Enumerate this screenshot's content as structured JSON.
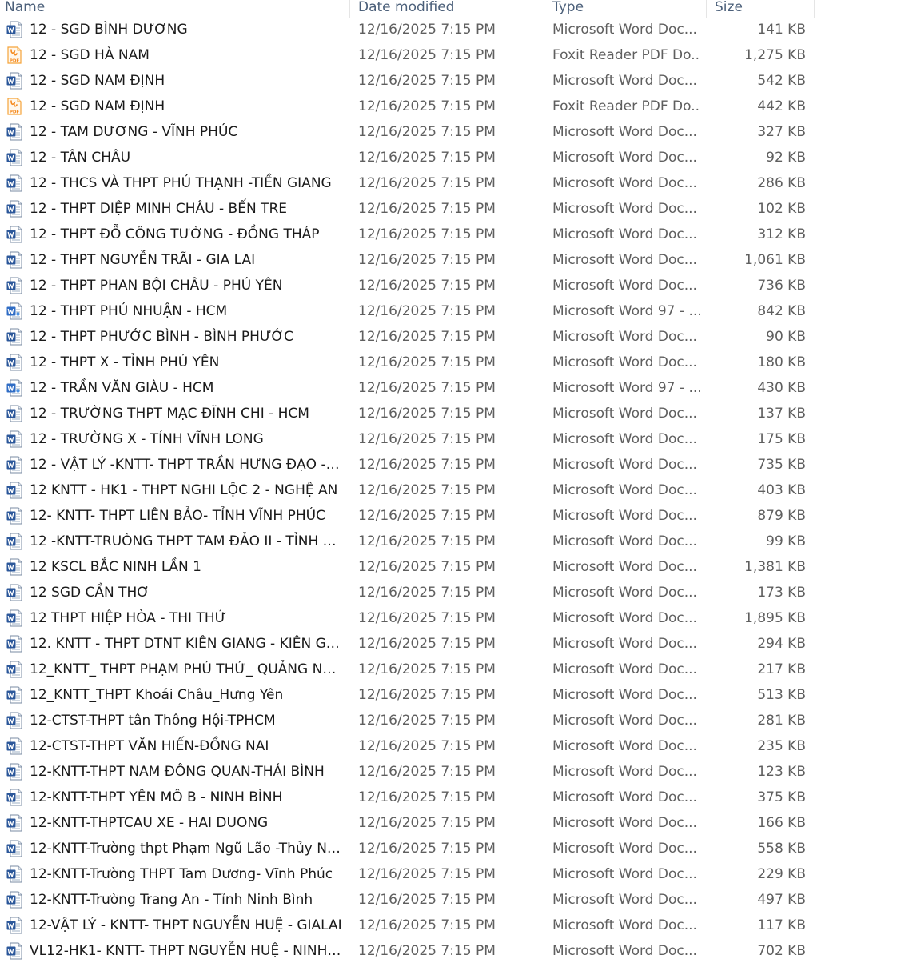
{
  "columns": {
    "name": "Name",
    "date": "Date modified",
    "type": "Type",
    "size": "Size"
  },
  "icons": {
    "word": "word-document-icon",
    "pdf": "foxit-pdf-icon",
    "word97": "word-97-document-icon"
  },
  "colors": {
    "word_blue": "#2b579a",
    "pdf_orange": "#f5a43a",
    "header_text": "#4c607a"
  },
  "files": [
    {
      "name": "12 - SGD BÌNH DƯƠNG",
      "date": "12/16/2025 7:15 PM",
      "type": "Microsoft Word Doc...",
      "size": "141 KB",
      "icon": "word"
    },
    {
      "name": "12 - SGD HÀ NAM",
      "date": "12/16/2025 7:15 PM",
      "type": "Foxit Reader PDF Do...",
      "size": "1,275 KB",
      "icon": "pdf"
    },
    {
      "name": "12 - SGD NAM ĐỊNH",
      "date": "12/16/2025 7:15 PM",
      "type": "Microsoft Word Doc...",
      "size": "542 KB",
      "icon": "word"
    },
    {
      "name": "12 - SGD NAM ĐỊNH",
      "date": "12/16/2025 7:15 PM",
      "type": "Foxit Reader PDF Do...",
      "size": "442 KB",
      "icon": "pdf"
    },
    {
      "name": "12 - TAM DƯƠNG - VĨNH PHÚC",
      "date": "12/16/2025 7:15 PM",
      "type": "Microsoft Word Doc...",
      "size": "327 KB",
      "icon": "word"
    },
    {
      "name": "12 - TÂN CHÂU",
      "date": "12/16/2025 7:15 PM",
      "type": "Microsoft Word Doc...",
      "size": "92 KB",
      "icon": "word"
    },
    {
      "name": "12 - THCS VÀ THPT PHÚ THẠNH -TIỀN GIANG",
      "date": "12/16/2025 7:15 PM",
      "type": "Microsoft Word Doc...",
      "size": "286 KB",
      "icon": "word"
    },
    {
      "name": "12 - THPT DIỆP MINH CHÂU - BẾN TRE",
      "date": "12/16/2025 7:15 PM",
      "type": "Microsoft Word Doc...",
      "size": "102 KB",
      "icon": "word"
    },
    {
      "name": "12 - THPT ĐỖ CÔNG TƯỜNG - ĐỒNG THÁP",
      "date": "12/16/2025 7:15 PM",
      "type": "Microsoft Word Doc...",
      "size": "312 KB",
      "icon": "word"
    },
    {
      "name": "12 - THPT NGUYỄN TRÃI - GIA LAI",
      "date": "12/16/2025 7:15 PM",
      "type": "Microsoft Word Doc...",
      "size": "1,061 KB",
      "icon": "word"
    },
    {
      "name": "12 - THPT PHAN BỘI CHÂU - PHÚ YÊN",
      "date": "12/16/2025 7:15 PM",
      "type": "Microsoft Word Doc...",
      "size": "736 KB",
      "icon": "word"
    },
    {
      "name": "12 - THPT PHÚ NHUẬN - HCM",
      "date": "12/16/2025 7:15 PM",
      "type": "Microsoft Word 97 - ...",
      "size": "842 KB",
      "icon": "word97"
    },
    {
      "name": "12 - THPT PHƯỚC BÌNH - BÌNH PHƯỚC",
      "date": "12/16/2025 7:15 PM",
      "type": "Microsoft Word Doc...",
      "size": "90 KB",
      "icon": "word"
    },
    {
      "name": "12 - THPT X - TỈNH PHÚ YÊN",
      "date": "12/16/2025 7:15 PM",
      "type": "Microsoft Word Doc...",
      "size": "180 KB",
      "icon": "word"
    },
    {
      "name": "12 - TRẦN VĂN GIÀU - HCM",
      "date": "12/16/2025 7:15 PM",
      "type": "Microsoft Word 97 - ...",
      "size": "430 KB",
      "icon": "word97"
    },
    {
      "name": "12 - TRƯỜNG THPT MẠC ĐĨNH CHI - HCM",
      "date": "12/16/2025 7:15 PM",
      "type": "Microsoft Word Doc...",
      "size": "137 KB",
      "icon": "word"
    },
    {
      "name": "12 - TRƯỜNG X - TỈNH VĨNH LONG",
      "date": "12/16/2025 7:15 PM",
      "type": "Microsoft Word Doc...",
      "size": "175 KB",
      "icon": "word"
    },
    {
      "name": "12 - VẬT LÝ -KNTT-  THPT TRẦN HƯNG ĐẠO - ...",
      "date": "12/16/2025 7:15 PM",
      "type": "Microsoft Word Doc...",
      "size": "735 KB",
      "icon": "word"
    },
    {
      "name": "12 KNTT - HK1 - THPT NGHI LỘC 2 - NGHỆ AN",
      "date": "12/16/2025 7:15 PM",
      "type": "Microsoft Word Doc...",
      "size": "403 KB",
      "icon": "word"
    },
    {
      "name": "12- KNTT- THPT LIÊN BẢO- TỈNH VĨNH PHÚC",
      "date": "12/16/2025 7:15 PM",
      "type": "Microsoft Word Doc...",
      "size": "879 KB",
      "icon": "word"
    },
    {
      "name": "12 -KNTT-TRUÒNG THPT TAM ĐẢO II - TỈNH VĨ...",
      "date": "12/16/2025 7:15 PM",
      "type": "Microsoft Word Doc...",
      "size": "99 KB",
      "icon": "word"
    },
    {
      "name": "12 KSCL BẮC NINH LẦN 1",
      "date": "12/16/2025 7:15 PM",
      "type": "Microsoft Word Doc...",
      "size": "1,381 KB",
      "icon": "word"
    },
    {
      "name": "12 SGD CẦN THƠ",
      "date": "12/16/2025 7:15 PM",
      "type": "Microsoft Word Doc...",
      "size": "173 KB",
      "icon": "word"
    },
    {
      "name": "12 THPT HIỆP HÒA - THI THỬ",
      "date": "12/16/2025 7:15 PM",
      "type": "Microsoft Word Doc...",
      "size": "1,895 KB",
      "icon": "word"
    },
    {
      "name": "12. KNTT - THPT DTNT KIÊN GIANG - KIÊN GIANG",
      "date": "12/16/2025 7:15 PM",
      "type": "Microsoft Word Doc...",
      "size": "294 KB",
      "icon": "word"
    },
    {
      "name": "12_KNTT_ THPT PHẠM PHÚ THỨ_ QUẢNG NAM",
      "date": "12/16/2025 7:15 PM",
      "type": "Microsoft Word Doc...",
      "size": "217 KB",
      "icon": "word"
    },
    {
      "name": "12_KNTT_THPT Khoái Châu_Hưng Yên",
      "date": "12/16/2025 7:15 PM",
      "type": "Microsoft Word Doc...",
      "size": "513 KB",
      "icon": "word"
    },
    {
      "name": "12-CTST-THPT tân Thông Hội-TPHCM",
      "date": "12/16/2025 7:15 PM",
      "type": "Microsoft Word Doc...",
      "size": "281 KB",
      "icon": "word"
    },
    {
      "name": "12-CTST-THPT VĂN HIẾN-ĐỒNG NAI",
      "date": "12/16/2025 7:15 PM",
      "type": "Microsoft Word Doc...",
      "size": "235 KB",
      "icon": "word"
    },
    {
      "name": "12-KNTT-THPT NAM ĐÔNG QUAN-THÁI BÌNH",
      "date": "12/16/2025 7:15 PM",
      "type": "Microsoft Word Doc...",
      "size": "123 KB",
      "icon": "word"
    },
    {
      "name": "12-KNTT-THPT YÊN MÔ B - NINH BÌNH",
      "date": "12/16/2025 7:15 PM",
      "type": "Microsoft Word Doc...",
      "size": "375 KB",
      "icon": "word"
    },
    {
      "name": "12-KNTT-THPTCAU XE - HAI DUONG",
      "date": "12/16/2025 7:15 PM",
      "type": "Microsoft Word Doc...",
      "size": "166 KB",
      "icon": "word"
    },
    {
      "name": "12-KNTT-Trường thpt Phạm Ngũ Lão -Thủy Ng...",
      "date": "12/16/2025 7:15 PM",
      "type": "Microsoft Word Doc...",
      "size": "558 KB",
      "icon": "word"
    },
    {
      "name": "12-KNTT-Trường THPT Tam Dương- Vĩnh Phúc",
      "date": "12/16/2025 7:15 PM",
      "type": "Microsoft Word Doc...",
      "size": "229 KB",
      "icon": "word"
    },
    {
      "name": "12-KNTT-Trường Trang An - Tỉnh Ninh Bình",
      "date": "12/16/2025 7:15 PM",
      "type": "Microsoft Word Doc...",
      "size": "497 KB",
      "icon": "word"
    },
    {
      "name": "12-VẬT LÝ - KNTT- THPT NGUYỄN HUỆ - GIALAI",
      "date": "12/16/2025 7:15 PM",
      "type": "Microsoft Word Doc...",
      "size": "117 KB",
      "icon": "word"
    },
    {
      "name": "VL12-HK1- KNTT- THPT NGUYỄN HUỆ - NINH B...",
      "date": "12/16/2025 7:15 PM",
      "type": "Microsoft Word Doc...",
      "size": "702 KB",
      "icon": "word"
    }
  ]
}
